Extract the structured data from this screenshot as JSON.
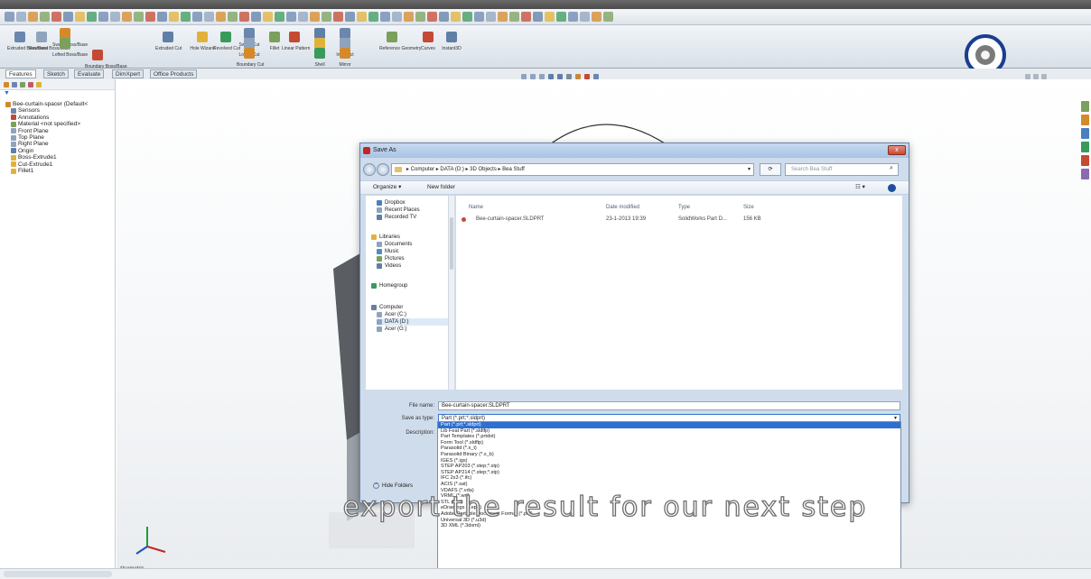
{
  "app": {
    "title": "SolidWorks"
  },
  "ribbon": {
    "buttons": [
      {
        "label": "Extruded Boss/Base"
      },
      {
        "label": "Revolved Boss/Base"
      },
      {
        "label": "Swept Boss/Base"
      },
      {
        "label": "Lofted Boss/Base"
      },
      {
        "label": "Boundary Boss/Base"
      },
      {
        "label": "Extruded Cut"
      },
      {
        "label": "Hole Wizard"
      },
      {
        "label": "Revolved Cut"
      },
      {
        "label": "Swept Cut"
      },
      {
        "label": "Lofted Cut"
      },
      {
        "label": "Boundary Cut"
      },
      {
        "label": "Fillet"
      },
      {
        "label": "Linear Pattern"
      },
      {
        "label": "Rib"
      },
      {
        "label": "Draft"
      },
      {
        "label": "Shell"
      },
      {
        "label": "Wrap"
      },
      {
        "label": "Intersect"
      },
      {
        "label": "Mirror"
      },
      {
        "label": "Reference Geometry"
      },
      {
        "label": "Curves"
      },
      {
        "label": "Instant3D"
      }
    ]
  },
  "panel_tabs": [
    "Features",
    "Sketch",
    "Evaluate",
    "DimXpert",
    "Office Products"
  ],
  "feature_tree": {
    "items": [
      "Bee-curtain-spacer (Default<",
      "Sensors",
      "Annotations",
      "Material <not specified>",
      "Front Plane",
      "Top Plane",
      "Right Plane",
      "Origin",
      "Boss-Extrude1",
      "Cut-Extrude1",
      "Fillet1"
    ]
  },
  "dialog": {
    "title": "Save As",
    "address": "▸ Computer ▸ DATA (D:) ▸ 3D Objects ▸ Bea Stuff",
    "search_placeholder": "Search Bea Stuff",
    "organize": "Organize ▾",
    "new_folder": "New folder",
    "nav": [
      "Dropbox",
      "Recent Places",
      "Recorded TV",
      "Libraries",
      "Documents",
      "Music",
      "Pictures",
      "Videos",
      "Homegroup",
      "Computer",
      "Acer (C:)",
      "DATA (D:)",
      "Acer (G:)"
    ],
    "columns": [
      "Name",
      "Date modified",
      "Type",
      "Size"
    ],
    "files": [
      {
        "name": "Bee-curtain-spacer.SLDPRT",
        "date": "23-1-2013 19:39",
        "type": "SolidWorks Part D...",
        "size": "156 KB"
      }
    ],
    "file_name_label": "File name:",
    "file_name_value": "Bee-curtain-spacer.SLDPRT",
    "save_type_label": "Save as type:",
    "save_type_value": "Part (*.prt;*.sldprt)",
    "description_label": "Description:",
    "hide_folders": "Hide Folders",
    "close": "x"
  },
  "type_options": [
    "Part (*.prt;*.sldprt)",
    "Lib Feat Part (*.sldlfp)",
    "Part Templates (*.prtdot)",
    "Form Tool (*.sldftp)",
    "Parasolid (*.x_t)",
    "Parasolid Binary (*.x_b)",
    "IGES (*.igs)",
    "STEP AP203 (*.step;*.stp)",
    "STEP AP214 (*.step;*.stp)",
    "IFC 2x3 (*.ifc)",
    "ACIS (*.sat)",
    "VDAFS (*.vda)",
    "VRML (*.wrl)",
    "STL (*.stl)",
    "eDrawings (*.eprt)",
    "Adobe Portable Document Format (*.pdf)",
    "Universal 3D (*.u3d)",
    "3D XML (*.3dxml)"
  ],
  "caption": "export the result for our next step",
  "status": {
    "trimetric": "*Isometric"
  },
  "colors": {
    "accent": "#1f6fc9",
    "highlight": "#2f6fd0",
    "ring": "#1a3d8f"
  }
}
